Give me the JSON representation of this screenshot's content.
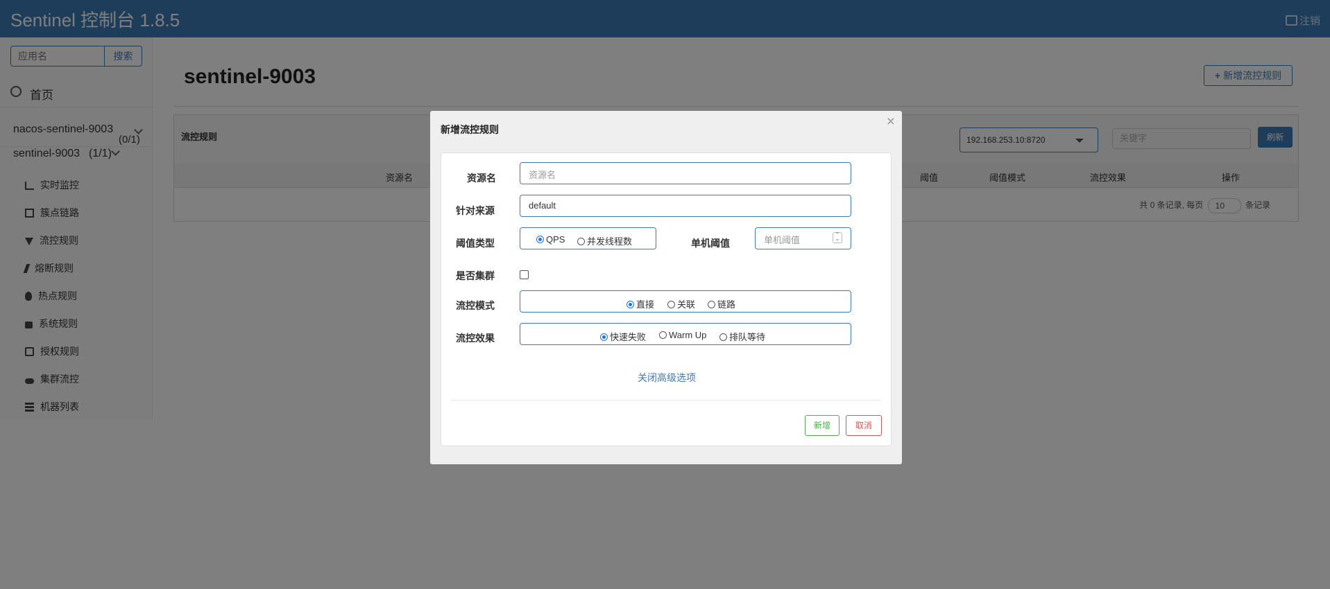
{
  "header": {
    "title": "Sentinel 控制台 1.8.5",
    "logout": "注销"
  },
  "sidebar": {
    "search_placeholder": "应用名",
    "search_button": "搜索",
    "home": "首页",
    "apps": [
      {
        "name": "nacos-sentinel-9003",
        "count": "(0/1)"
      },
      {
        "name": "sentinel-9003",
        "count": "(1/1)"
      }
    ],
    "menu": [
      {
        "label": "实时监控",
        "icon": "bar-chart-icon"
      },
      {
        "label": "簇点链路",
        "icon": "list-icon"
      },
      {
        "label": "流控规则",
        "icon": "filter-icon"
      },
      {
        "label": "熔断规则",
        "icon": "flash-icon"
      },
      {
        "label": "热点规则",
        "icon": "fire-icon"
      },
      {
        "label": "系统规则",
        "icon": "lock-icon"
      },
      {
        "label": "授权规则",
        "icon": "check-icon"
      },
      {
        "label": "集群流控",
        "icon": "cloud-icon"
      },
      {
        "label": "机器列表",
        "icon": "table-icon"
      }
    ]
  },
  "main": {
    "title": "sentinel-9003",
    "add_button": "新增流控规则",
    "panel_title": "流控规则",
    "machine": "192.168.253.10:8720",
    "keyword_placeholder": "关键字",
    "refresh": "刷新",
    "columns": [
      "资源名",
      "阈值",
      "阈值模式",
      "流控效果",
      "操作"
    ],
    "pager": {
      "prefix": "共 0 条记录, 每页",
      "page_size": "10",
      "suffix": "条记录"
    }
  },
  "modal": {
    "title": "新增流控规则",
    "close": "×",
    "resource_label": "资源名",
    "resource_placeholder": "资源名",
    "limitapp_label": "针对来源",
    "limitapp_value": "default",
    "grade_label": "阈值类型",
    "grade_options": [
      "QPS",
      "并发线程数"
    ],
    "grade_selected": "QPS",
    "count_label": "单机阈值",
    "count_placeholder": "单机阈值",
    "cluster_label": "是否集群",
    "cluster_checked": false,
    "strategy_label": "流控模式",
    "strategy_options": [
      "直接",
      "关联",
      "链路"
    ],
    "strategy_selected": "直接",
    "behavior_label": "流控效果",
    "behavior_options": [
      "快速失败",
      "Warm Up",
      "排队等待"
    ],
    "behavior_selected": "快速失败",
    "advanced_link": "关闭高级选项",
    "submit": "新增",
    "cancel": "取消"
  },
  "colors": {
    "primary": "#3c7ab7",
    "success": "#4cae4c",
    "danger": "#d9534f",
    "radio_selected": "#1a73e8"
  }
}
